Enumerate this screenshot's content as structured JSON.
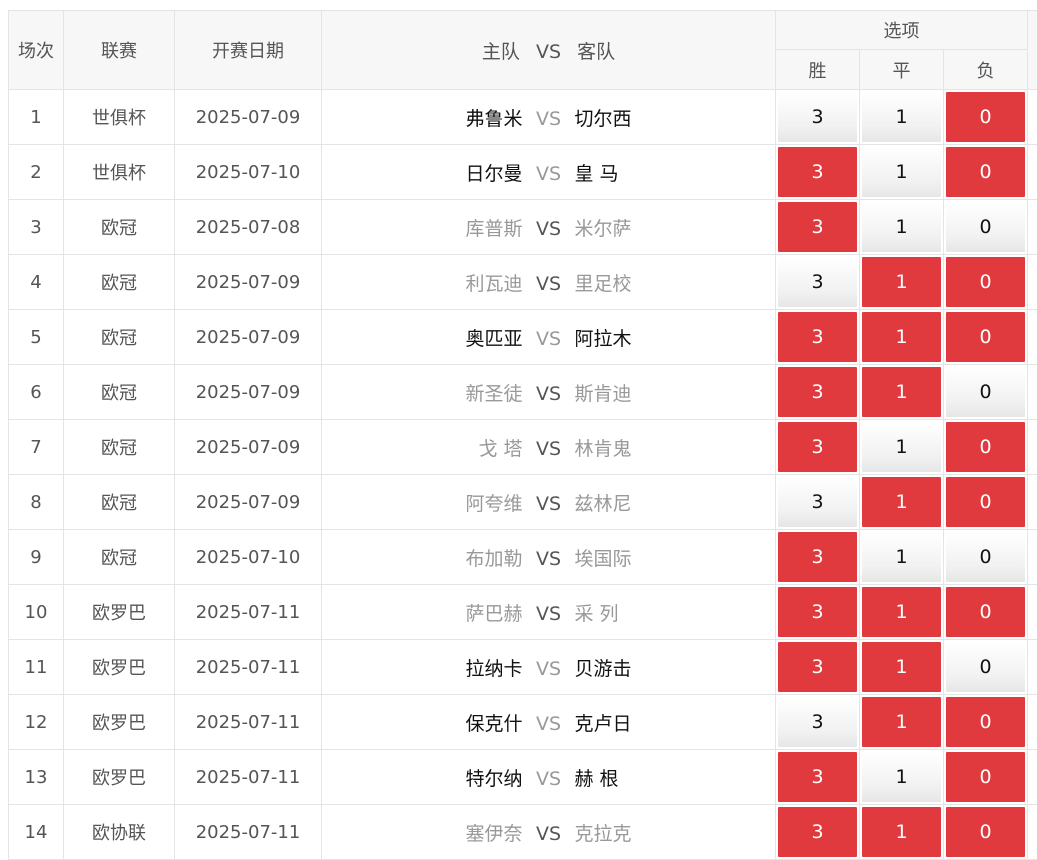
{
  "header": {
    "index": "场次",
    "league": "联赛",
    "date": "开赛日期",
    "home": "主队",
    "vs": "VS",
    "away": "客队",
    "options_group": "选项",
    "win": "胜",
    "draw": "平",
    "lose": "负"
  },
  "colors": {
    "selected": "#e03a3e",
    "dark_team": "#111111",
    "light_team": "#999999"
  },
  "rows": [
    {
      "idx": "1",
      "league": "世俱杯",
      "date": "2025-07-09",
      "home": "弗鲁米",
      "vs": "VS",
      "away": "切尔西",
      "style": "dark",
      "win": "3",
      "draw": "1",
      "lose": "0",
      "sel": [
        false,
        false,
        true
      ]
    },
    {
      "idx": "2",
      "league": "世俱杯",
      "date": "2025-07-10",
      "home": "日尔曼",
      "vs": "VS",
      "away": "皇 马",
      "style": "dark",
      "win": "3",
      "draw": "1",
      "lose": "0",
      "sel": [
        true,
        false,
        true
      ]
    },
    {
      "idx": "3",
      "league": "欧冠",
      "date": "2025-07-08",
      "home": "库普斯",
      "vs": "VS",
      "away": "米尔萨",
      "style": "light",
      "win": "3",
      "draw": "1",
      "lose": "0",
      "sel": [
        true,
        false,
        false
      ]
    },
    {
      "idx": "4",
      "league": "欧冠",
      "date": "2025-07-09",
      "home": "利瓦迪",
      "vs": "VS",
      "away": "里足校",
      "style": "light",
      "win": "3",
      "draw": "1",
      "lose": "0",
      "sel": [
        false,
        true,
        true
      ]
    },
    {
      "idx": "5",
      "league": "欧冠",
      "date": "2025-07-09",
      "home": "奥匹亚",
      "vs": "VS",
      "away": "阿拉木",
      "style": "dark",
      "win": "3",
      "draw": "1",
      "lose": "0",
      "sel": [
        true,
        true,
        true
      ]
    },
    {
      "idx": "6",
      "league": "欧冠",
      "date": "2025-07-09",
      "home": "新圣徒",
      "vs": "VS",
      "away": "斯肯迪",
      "style": "light",
      "win": "3",
      "draw": "1",
      "lose": "0",
      "sel": [
        true,
        true,
        false
      ]
    },
    {
      "idx": "7",
      "league": "欧冠",
      "date": "2025-07-09",
      "home": "戈 塔",
      "vs": "VS",
      "away": "林肯鬼",
      "style": "light",
      "win": "3",
      "draw": "1",
      "lose": "0",
      "sel": [
        true,
        false,
        true
      ]
    },
    {
      "idx": "8",
      "league": "欧冠",
      "date": "2025-07-09",
      "home": "阿夸维",
      "vs": "VS",
      "away": "兹林尼",
      "style": "light",
      "win": "3",
      "draw": "1",
      "lose": "0",
      "sel": [
        false,
        true,
        true
      ]
    },
    {
      "idx": "9",
      "league": "欧冠",
      "date": "2025-07-10",
      "home": "布加勒",
      "vs": "VS",
      "away": "埃国际",
      "style": "light",
      "win": "3",
      "draw": "1",
      "lose": "0",
      "sel": [
        true,
        false,
        false
      ]
    },
    {
      "idx": "10",
      "league": "欧罗巴",
      "date": "2025-07-11",
      "home": "萨巴赫",
      "vs": "VS",
      "away": "采 列",
      "style": "light",
      "win": "3",
      "draw": "1",
      "lose": "0",
      "sel": [
        true,
        true,
        true
      ]
    },
    {
      "idx": "11",
      "league": "欧罗巴",
      "date": "2025-07-11",
      "home": "拉纳卡",
      "vs": "VS",
      "away": "贝游击",
      "style": "dark",
      "win": "3",
      "draw": "1",
      "lose": "0",
      "sel": [
        true,
        true,
        false
      ]
    },
    {
      "idx": "12",
      "league": "欧罗巴",
      "date": "2025-07-11",
      "home": "保克什",
      "vs": "VS",
      "away": "克卢日",
      "style": "dark",
      "win": "3",
      "draw": "1",
      "lose": "0",
      "sel": [
        false,
        true,
        true
      ]
    },
    {
      "idx": "13",
      "league": "欧罗巴",
      "date": "2025-07-11",
      "home": "特尔纳",
      "vs": "VS",
      "away": "赫 根",
      "style": "dark",
      "win": "3",
      "draw": "1",
      "lose": "0",
      "sel": [
        true,
        false,
        true
      ]
    },
    {
      "idx": "14",
      "league": "欧协联",
      "date": "2025-07-11",
      "home": "塞伊奈",
      "vs": "VS",
      "away": "克拉克",
      "style": "light",
      "win": "3",
      "draw": "1",
      "lose": "0",
      "sel": [
        true,
        true,
        true
      ]
    }
  ]
}
